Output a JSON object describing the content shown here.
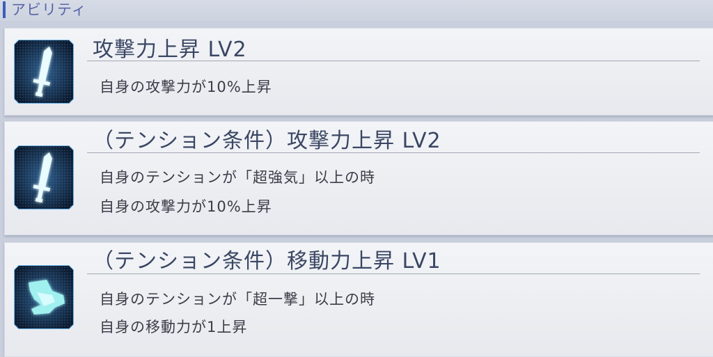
{
  "section": {
    "title": "アビリティ"
  },
  "abilities": [
    {
      "title": "攻撃力上昇 LV2",
      "icon": "sword-icon",
      "lines": [
        "自身の攻撃力が10%上昇"
      ]
    },
    {
      "title": "（テンション条件）攻撃力上昇 LV2",
      "icon": "sword-icon",
      "lines": [
        "自身のテンションが「超強気」以上の時",
        "自身の攻撃力が10%上昇"
      ]
    },
    {
      "title": "（テンション条件）移動力上昇 LV1",
      "icon": "boot-icon",
      "lines": [
        "自身のテンションが「超一撃」以上の時",
        "自身の移動力が1上昇"
      ]
    }
  ]
}
